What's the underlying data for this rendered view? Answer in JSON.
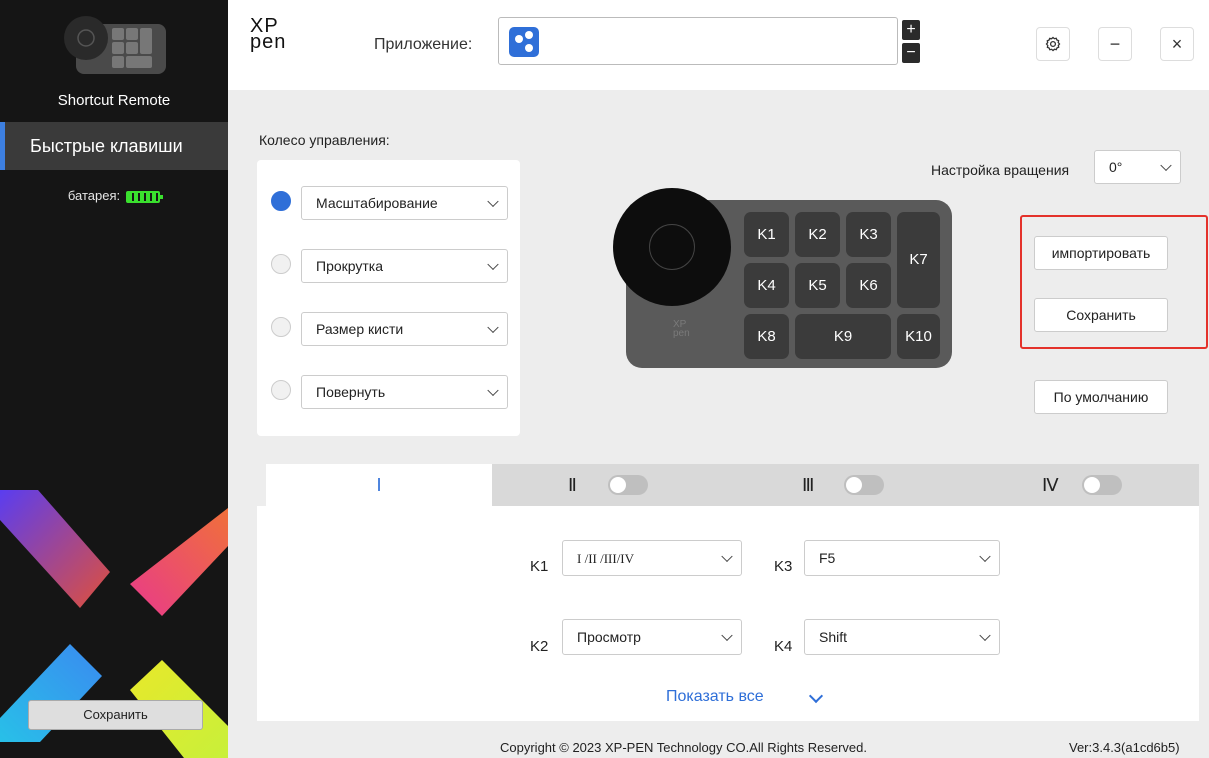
{
  "sidebar": {
    "device_name": "Shortcut Remote",
    "nav_label": "Быстрые клавиши",
    "battery_label": "батарея:",
    "save_label": "Сохранить"
  },
  "header": {
    "logo_line1": "XP",
    "logo_line2": "pen",
    "app_label": "Приложение:",
    "plus": "+",
    "minus": "−",
    "settings_icon": "gear-icon",
    "minimize": "−",
    "close": "×"
  },
  "wheel": {
    "title": "Колесо управления:",
    "options": [
      {
        "label": "Масштабирование",
        "selected": true
      },
      {
        "label": "Прокрутка",
        "selected": false
      },
      {
        "label": "Размер кисти",
        "selected": false
      },
      {
        "label": "Повернуть",
        "selected": false
      }
    ]
  },
  "rotation": {
    "label": "Настройка вращения",
    "value": "0°"
  },
  "device": {
    "logo_line1": "XP",
    "logo_line2": "pen",
    "keys": [
      "K1",
      "K2",
      "K3",
      "K4",
      "K5",
      "K6",
      "K7",
      "K8",
      "K9",
      "K10"
    ]
  },
  "actions": {
    "import": "импортировать",
    "save": "Сохранить",
    "default": "По умолчанию"
  },
  "tabs": [
    {
      "label": "I",
      "active": true,
      "enabled": true
    },
    {
      "label": "Ⅱ",
      "active": false,
      "enabled": false
    },
    {
      "label": "Ⅲ",
      "active": false,
      "enabled": false
    },
    {
      "label": "Ⅳ",
      "active": false,
      "enabled": false
    }
  ],
  "key_settings": [
    {
      "key": "K1",
      "value": "I /II /III/IV"
    },
    {
      "key": "K3",
      "value": "F5"
    },
    {
      "key": "K2",
      "value": "Просмотр"
    },
    {
      "key": "K4",
      "value": "Shift"
    }
  ],
  "show_all": "Показать все",
  "footer": {
    "copyright": "Copyright © 2023  XP-PEN Technology CO.All Rights Reserved.",
    "version": "Ver:3.4.3(a1cd6b5)"
  },
  "colors": {
    "accent": "#2f6fd8",
    "sidebar_bg": "#151515",
    "battery": "#3ae02e",
    "highlight_frame": "#e4322b"
  }
}
